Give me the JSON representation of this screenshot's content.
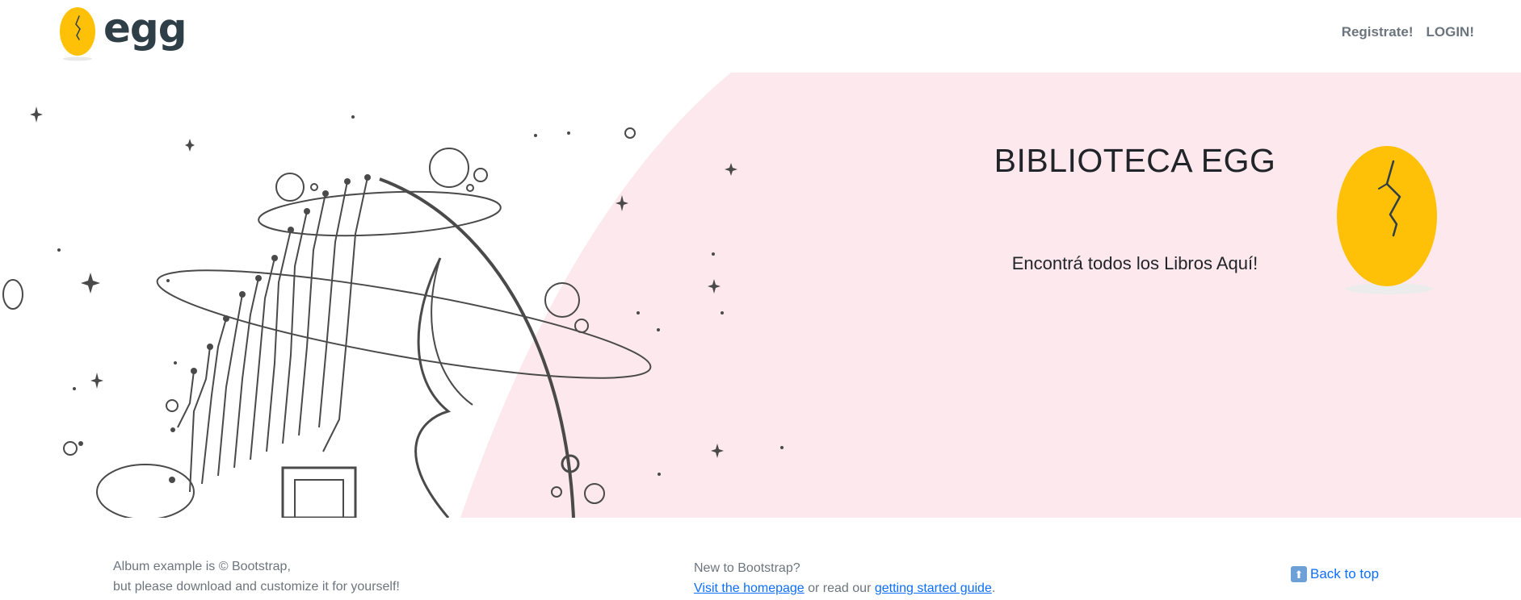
{
  "header": {
    "logo_text": "egg",
    "nav": [
      {
        "label": "Registrate!"
      },
      {
        "label": "LOGIN!"
      }
    ]
  },
  "hero": {
    "title": "BIBLIOTECA EGG",
    "subtitle": "Encontrá todos los Libros Aquí!"
  },
  "footer": {
    "left_line1": "Album example is © Bootstrap,",
    "left_line2": "but please download and customize it for yourself!",
    "mid_line1": "New to Bootstrap?",
    "mid_link1": "Visit the homepage",
    "mid_text": " or read our ",
    "mid_link2": "getting started guide",
    "mid_end": ".",
    "back_to_top": "Back to top"
  },
  "colors": {
    "egg_yellow": "#ffc107",
    "hero_pink": "#fde8ee",
    "link_blue": "#0d6efd",
    "text_muted": "#6c757d"
  },
  "icons": [
    "egg-logo-icon",
    "egg-illustration-icon",
    "up-arrow-icon"
  ]
}
